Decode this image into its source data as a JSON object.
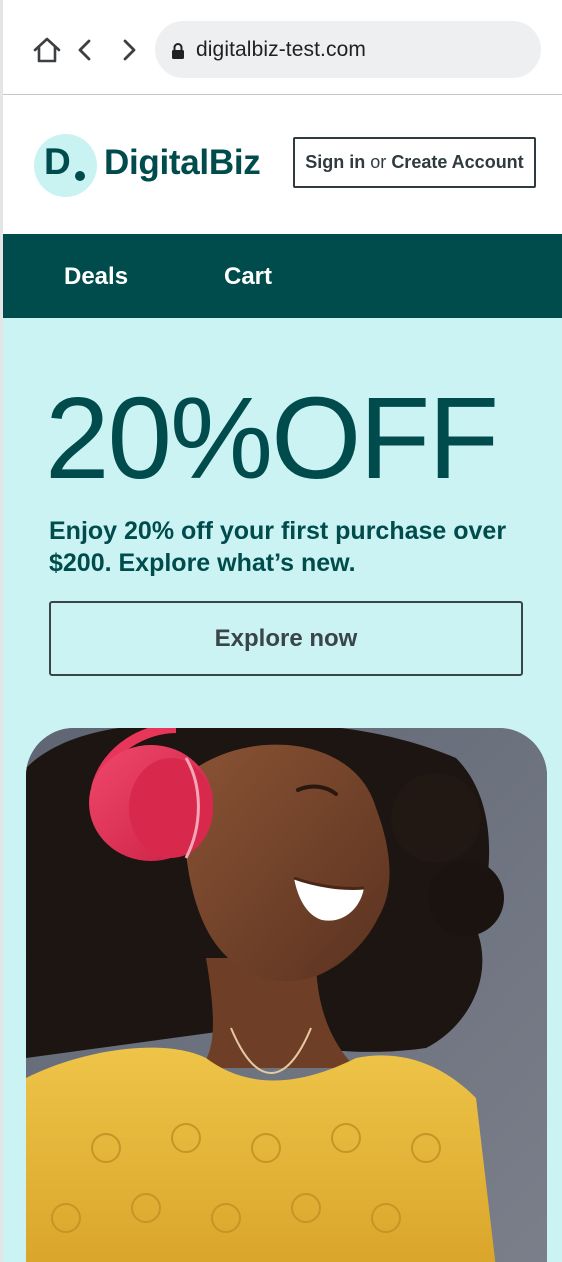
{
  "browser": {
    "url": "digitalbiz-test.com",
    "icons": [
      "home-icon",
      "back-icon",
      "forward-icon",
      "lock-icon"
    ]
  },
  "header": {
    "logo_letter": "D",
    "brand_name": "DigitalBiz",
    "sign_in": "Sign in",
    "or": "or",
    "create_account": "Create Account"
  },
  "nav": {
    "items": [
      {
        "label": "Deals"
      },
      {
        "label": "Cart"
      }
    ]
  },
  "hero": {
    "headline": "20%OFF",
    "description": "Enjoy 20% off your first purchase over $200. Explore what’s new.",
    "cta_label": "Explore now"
  },
  "colors": {
    "brand": "#004c4c",
    "hero_background": "#ccf3f3",
    "logo_background": "#c9f2f2",
    "headphones": "#e8355a",
    "sweater": "#e9b93a"
  }
}
